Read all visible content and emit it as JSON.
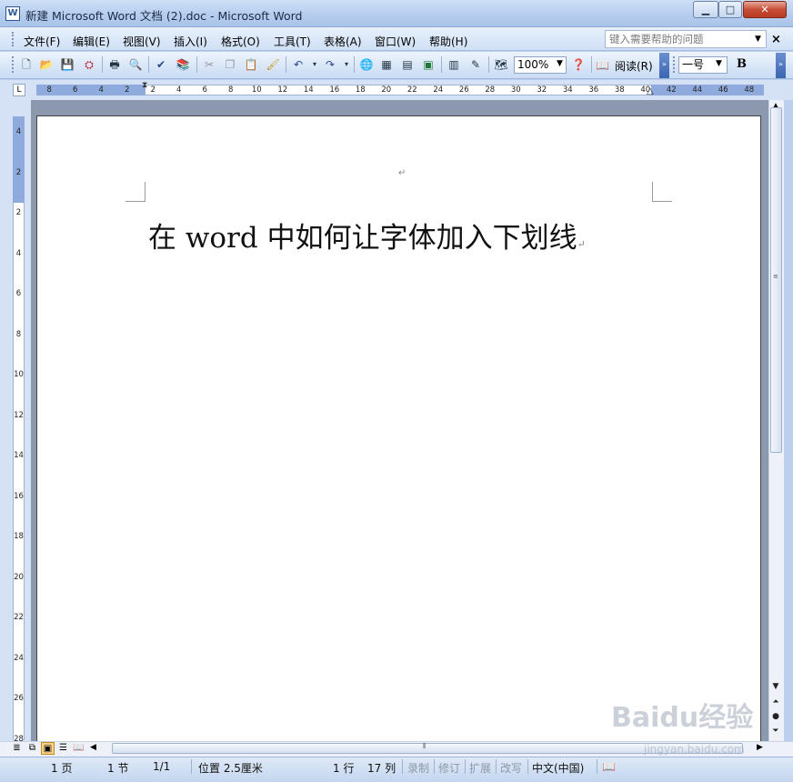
{
  "window": {
    "title": "新建 Microsoft Word 文档 (2).doc - Microsoft Word",
    "app_icon": "W",
    "buttons": {
      "minimize": "▁",
      "maximize": "□",
      "close": "✕"
    }
  },
  "menu": {
    "items": [
      "文件(F)",
      "编辑(E)",
      "视图(V)",
      "插入(I)",
      "格式(O)",
      "工具(T)",
      "表格(A)",
      "窗口(W)",
      "帮助(H)"
    ],
    "help_placeholder": "键入需要帮助的问题",
    "close_glyph": "×"
  },
  "toolbar": {
    "zoom": "100%",
    "read_label": "阅读(R)",
    "font_size": "一号",
    "bold_label": "B"
  },
  "ruler": {
    "corner": "L",
    "h_ticks": [
      "8",
      "6",
      "4",
      "2",
      "2",
      "4",
      "6",
      "8",
      "10",
      "12",
      "14",
      "16",
      "18",
      "20",
      "22",
      "24",
      "26",
      "28",
      "30",
      "32",
      "34",
      "36",
      "38",
      "40",
      "42",
      "44",
      "46",
      "48"
    ],
    "v_ticks": [
      "4",
      "2",
      "2",
      "4",
      "6",
      "8",
      "10",
      "12",
      "14",
      "16",
      "18",
      "20",
      "22",
      "24",
      "26",
      "28"
    ]
  },
  "document": {
    "header_mark": "↵",
    "line1": "在 word 中如何让字体加入下划线",
    "para_mark": "↵"
  },
  "status": {
    "page": "1 页",
    "section": "1 节",
    "pages": "1/1",
    "position": "位置 2.5厘米",
    "line": "1 行",
    "column": "17 列",
    "rec": "录制",
    "trk": "修订",
    "ext": "扩展",
    "ovr": "改写",
    "language": "中文(中国)"
  },
  "watermark": {
    "brand": "Baidu经验",
    "url": "jingyan.baidu.com"
  }
}
